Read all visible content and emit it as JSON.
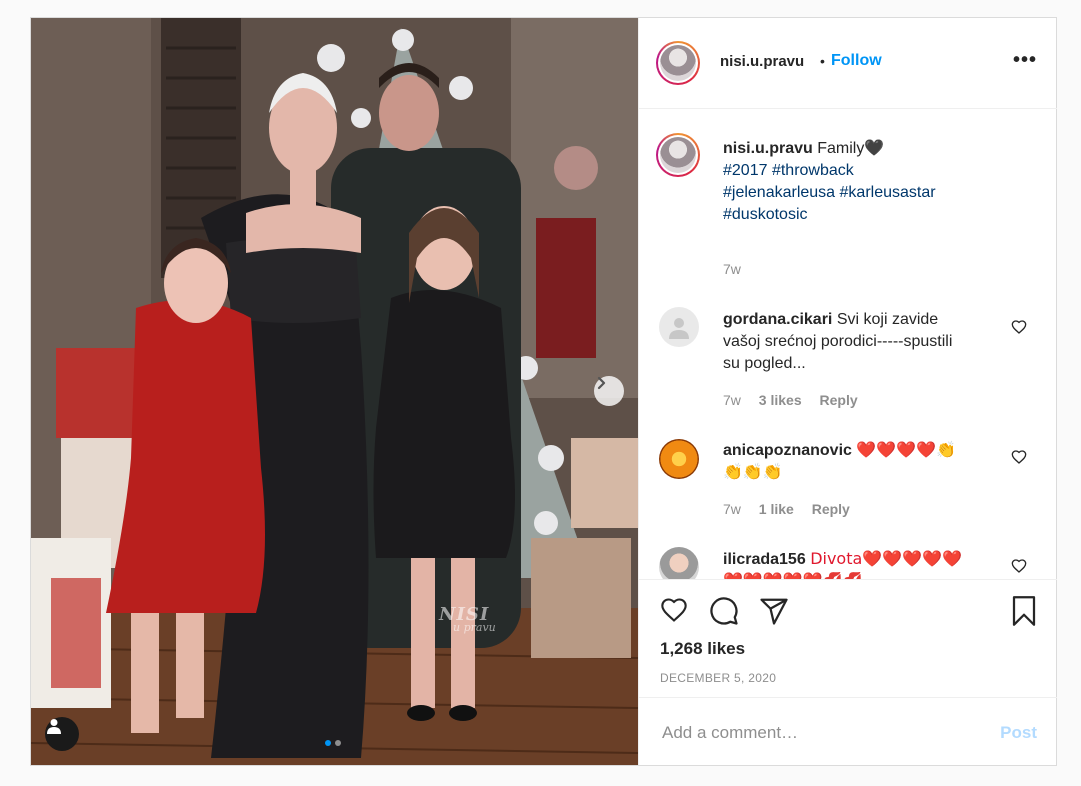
{
  "post": {
    "username": "nisi.u.pravu",
    "separator": "•",
    "follow_label": "Follow",
    "more_label": "•••",
    "watermark_main": "NISI",
    "watermark_sub": "u pravu",
    "caption": {
      "username": "nisi.u.pravu",
      "text": "Family🖤",
      "hashtags_line1": [
        "#2017",
        "#throwback"
      ],
      "hashtags_line2": [
        "#jelenakarleusa",
        "#karleusastar"
      ],
      "hashtags_line3": [
        "#duskotosic"
      ],
      "time": "7w"
    },
    "comments": [
      {
        "username": "gordana.cikari",
        "line1": "Svi koji zavide",
        "line2": "vašoj srećnoj porodici-----spustili",
        "line3": "su pogled...",
        "time": "7w",
        "likes": "3 likes",
        "reply": "Reply"
      },
      {
        "username": "anicapoznanovic",
        "line1": "❤️❤️❤️❤️👏",
        "line2": "👏👏👏",
        "time": "7w",
        "likes": "1 like",
        "reply": "Reply"
      },
      {
        "username": "ilicrada156",
        "line1": "Divota❤️❤️❤️❤️❤️",
        "line2": "❤️❤️❤️❤️❤️💋💋"
      }
    ],
    "likes": "1,268 likes",
    "date": "DECEMBER 5, 2020",
    "add_comment_placeholder": "Add a comment…",
    "post_label": "Post",
    "carousel": {
      "current": 1,
      "total": 2
    }
  },
  "colors": {
    "accent": "#0095f6",
    "hashtag": "#00376b",
    "muted": "#8e8e8e",
    "post_disabled": "#b3dbff"
  }
}
